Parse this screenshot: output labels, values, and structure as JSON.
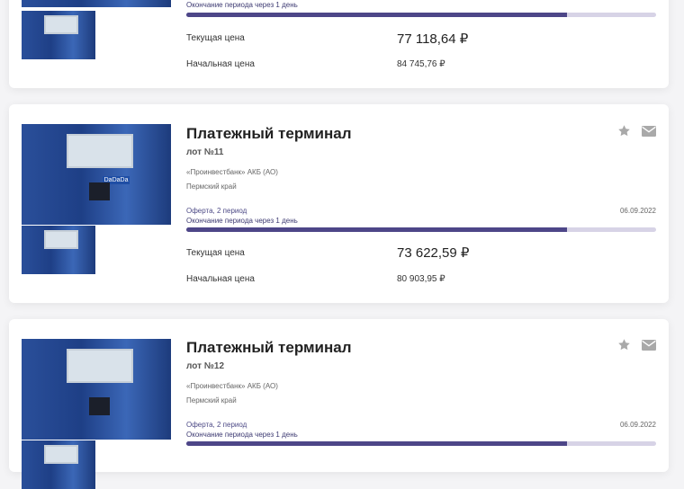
{
  "cards": [
    {
      "end_text": "Окончание периода через 1 день",
      "progress": 0.81,
      "current_label": "Текущая цена",
      "current_price": "77 118,64 ₽",
      "start_label": "Начальная цена",
      "start_price": "84 745,76 ₽"
    },
    {
      "title": "Платежный терминал",
      "lot": "лот №11",
      "org": "«Проинвестбанк» АКБ (АО)",
      "region": "Пермский край",
      "offer": "Оферта, 2 период",
      "date": "06.09.2022",
      "end_text": "Окончание периода через 1 день",
      "progress": 0.81,
      "current_label": "Текущая цена",
      "current_price": "73 622,59 ₽",
      "start_label": "Начальная цена",
      "start_price": "80 903,95 ₽"
    },
    {
      "title": "Платежный терминал",
      "lot": "лот №12",
      "org": "«Проинвестбанк» АКБ (АО)",
      "region": "Пермский край",
      "offer": "Оферта, 2 период",
      "date": "06.09.2022",
      "end_text": "Окончание периода через 1 день",
      "progress": 0.81
    }
  ],
  "icons": {
    "favorite": "star-icon",
    "mail": "mail-icon"
  },
  "colors": {
    "progress_fill": "#4d4688",
    "progress_track": "#d7d3e6",
    "icon": "#a9a9a9"
  },
  "image_label": "DaDaDa"
}
